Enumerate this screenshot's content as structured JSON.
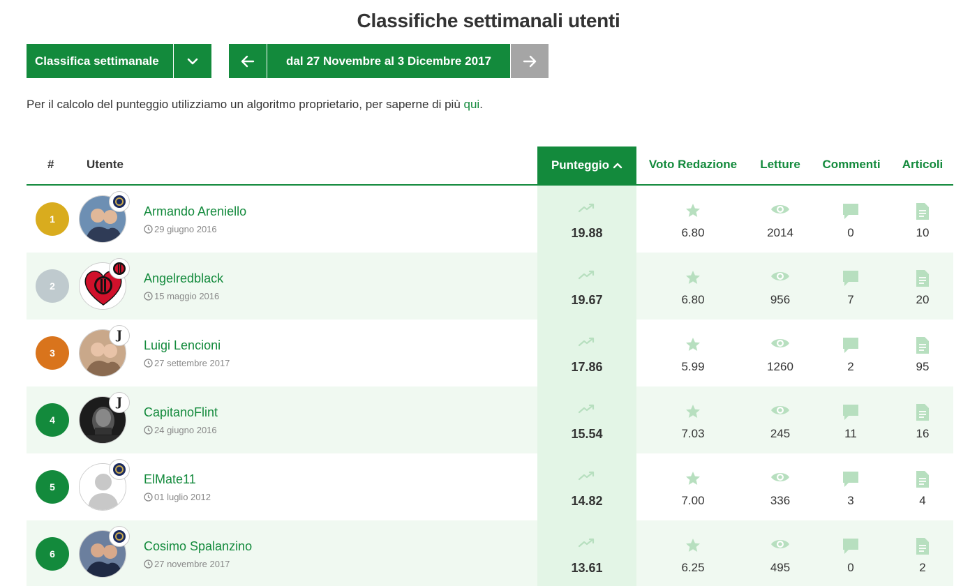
{
  "page": {
    "title": "Classifiche settimanali utenti"
  },
  "controls": {
    "period_label": "Classifica settimanale",
    "date_range": "dal 27 Novembre al 3 Dicembre 2017"
  },
  "info": {
    "text": "Per il calcolo del punteggio utilizziamo un algoritmo proprietario, per saperne di più ",
    "link": "qui",
    "suffix": "."
  },
  "table": {
    "headers": {
      "rank": "#",
      "user": "Utente",
      "score": "Punteggio",
      "voto": "Voto Redazione",
      "letture": "Letture",
      "commenti": "Commenti",
      "articoli": "Articoli"
    },
    "rows": [
      {
        "rank": "1",
        "rank_color": "#d9ac1e",
        "name": "Armando Areniello",
        "date": "29 giugno 2016",
        "score": "19.88",
        "voto": "6.80",
        "letture": "2014",
        "commenti": "0",
        "articoli": "10",
        "badge": "inter",
        "avatar": "photo"
      },
      {
        "rank": "2",
        "rank_color": "#bfcace",
        "name": "Angelredblack",
        "date": "15 maggio 2016",
        "score": "19.67",
        "voto": "6.80",
        "letture": "956",
        "commenti": "7",
        "articoli": "20",
        "badge": "milan",
        "avatar": "heart"
      },
      {
        "rank": "3",
        "rank_color": "#d9741c",
        "name": "Luigi Lencioni",
        "date": "27 settembre 2017",
        "score": "17.86",
        "voto": "5.99",
        "letture": "1260",
        "commenti": "2",
        "articoli": "95",
        "badge": "juventus",
        "avatar": "photo"
      },
      {
        "rank": "4",
        "rank_color": "#138a3c",
        "name": "CapitanoFlint",
        "date": "24 giugno 2016",
        "score": "15.54",
        "voto": "7.03",
        "letture": "245",
        "commenti": "11",
        "articoli": "16",
        "badge": "juventus",
        "avatar": "dark"
      },
      {
        "rank": "5",
        "rank_color": "#138a3c",
        "name": "ElMate11",
        "date": "01 luglio 2012",
        "score": "14.82",
        "voto": "7.00",
        "letture": "336",
        "commenti": "3",
        "articoli": "4",
        "badge": "inter",
        "avatar": "placeholder"
      },
      {
        "rank": "6",
        "rank_color": "#138a3c",
        "name": "Cosimo Spalanzino",
        "date": "27 novembre 2017",
        "score": "13.61",
        "voto": "6.25",
        "letture": "495",
        "commenti": "0",
        "articoli": "2",
        "badge": "inter",
        "avatar": "photo"
      }
    ]
  },
  "colors": {
    "brand_green": "#138a3c",
    "score_bg": "#e3f5e6",
    "row_alt_bg": "#f0f9f1",
    "icon_green": "#b7dfbf",
    "next_disabled": "#a5a5a5"
  },
  "icons": {
    "trend": "trending-up-icon",
    "star": "star-icon",
    "eye": "eye-icon",
    "comment": "comment-icon",
    "doc": "document-icon",
    "clock": "clock-icon"
  }
}
